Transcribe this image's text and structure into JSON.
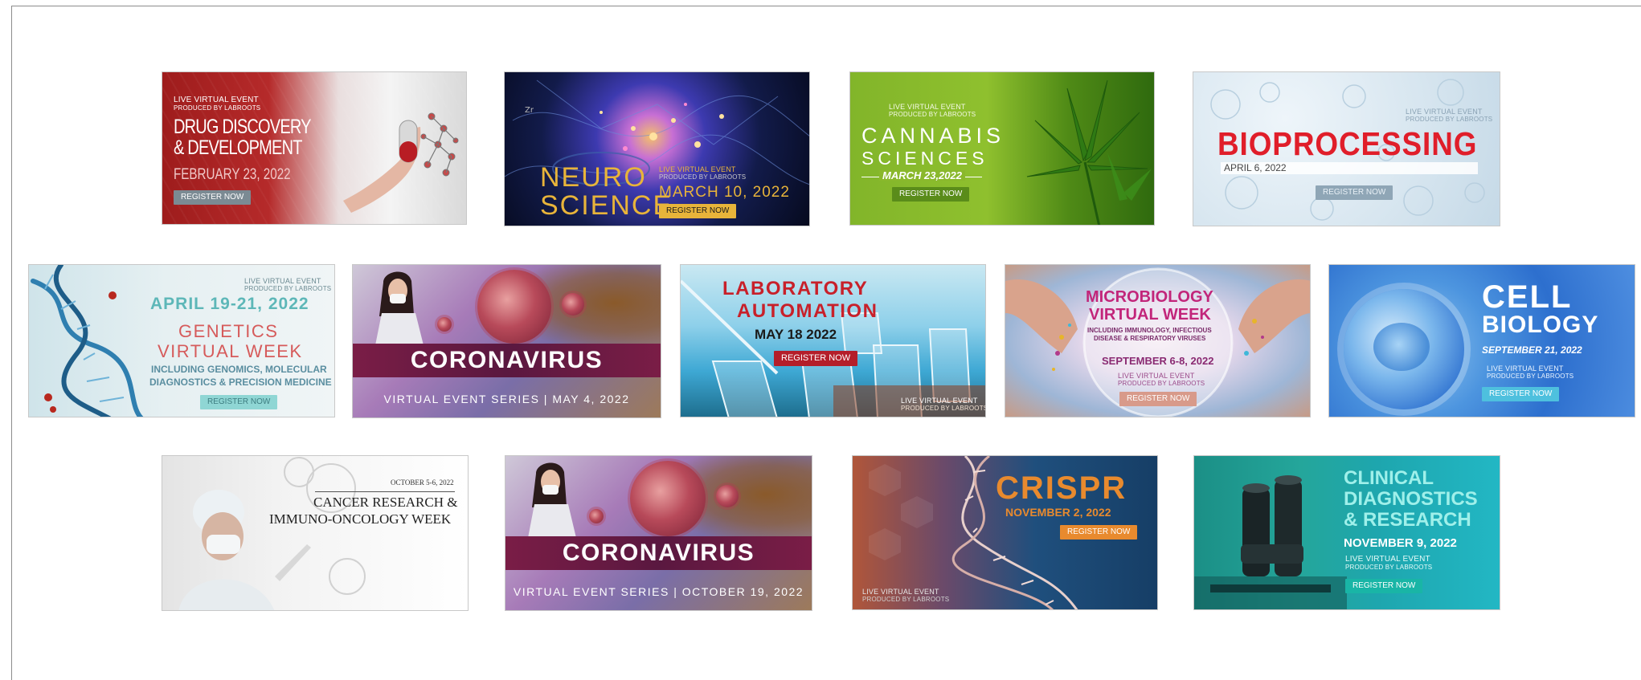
{
  "banners": {
    "drug": {
      "kicker": "LIVE VIRTUAL EVENT",
      "producer": "PRODUCED BY LABROOTS",
      "title_line1": "DRUG DISCOVERY",
      "title_line2": "& DEVELOPMENT",
      "date": "FEBRUARY 23, 2022",
      "button": "REGISTER NOW"
    },
    "neuro": {
      "title_line1": "NEURO",
      "title_line2": "SCIENCE",
      "kicker": "LIVE VIRTUAL EVENT",
      "producer": "PRODUCED BY LABROOTS",
      "date": "MARCH 10, 2022",
      "button": "REGISTER NOW"
    },
    "cannabis": {
      "kicker": "LIVE VIRTUAL EVENT",
      "producer": "PRODUCED BY LABROOTS",
      "title_line1": "CANNABIS",
      "title_line2": "SCIENCES",
      "date": "MARCH 23,2022",
      "button": "REGISTER NOW"
    },
    "bio": {
      "kicker": "LIVE VIRTUAL EVENT",
      "producer": "PRODUCED BY LABROOTS",
      "title": "BIOPROCESSING",
      "date": "APRIL 6, 2022",
      "button": "REGISTER NOW"
    },
    "genetics": {
      "kicker": "LIVE VIRTUAL EVENT",
      "producer": "PRODUCED BY LABROOTS",
      "date": "APRIL 19-21, 2022",
      "title_line1": "GENETICS",
      "title_line2": "VIRTUAL WEEK",
      "subtitle_line1": "INCLUDING GENOMICS, MOLECULAR",
      "subtitle_line2": "DIAGNOSTICS & PRECISION MEDICINE",
      "button": "REGISTER NOW"
    },
    "corona1": {
      "title": "CORONAVIRUS",
      "subtitle": "VIRTUAL EVENT SERIES  |  MAY 4, 2022"
    },
    "labauto": {
      "title_line1": "LABORATORY",
      "title_line2": "AUTOMATION",
      "date": "MAY 18  2022",
      "button": "REGISTER NOW",
      "kicker": "LIVE VIRTUAL EVENT",
      "producer": "PRODUCED BY LABROOTS"
    },
    "micro": {
      "title_line1": "MICROBIOLOGY",
      "title_line2": "VIRTUAL WEEK",
      "subtitle_line1": "INCLUDING IMMUNOLOGY, INFECTIOUS",
      "subtitle_line2": "DISEASE & RESPIRATORY VIRUSES",
      "date": "SEPTEMBER 6-8, 2022",
      "kicker": "LIVE VIRTUAL EVENT",
      "producer": "PRODUCED BY LABROOTS",
      "button": "REGISTER NOW"
    },
    "cell": {
      "title_line1": "CELL",
      "title_line2": "BIOLOGY",
      "date": "SEPTEMBER 21, 2022",
      "kicker": "LIVE VIRTUAL EVENT",
      "producer": "PRODUCED BY LABROOTS",
      "button": "REGISTER NOW"
    },
    "cancer": {
      "date": "OCTOBER 5-6, 2022",
      "title_line1": "CANCER RESEARCH &",
      "title_line2": "IMMUNO-ONCOLOGY WEEK"
    },
    "corona2": {
      "title": "CORONAVIRUS",
      "subtitle": "VIRTUAL EVENT SERIES | OCTOBER 19, 2022"
    },
    "crispr": {
      "title": "CRISPR",
      "date": "NOVEMBER 2, 2022",
      "button": "REGISTER NOW",
      "kicker": "LIVE VIRTUAL EVENT",
      "producer": "PRODUCED BY LABROOTS"
    },
    "clinical": {
      "title_line1": "CLINICAL",
      "title_line2": "DIAGNOSTICS",
      "title_line3": "& RESEARCH",
      "date": "NOVEMBER 9, 2022",
      "kicker": "LIVE VIRTUAL EVENT",
      "producer": "PRODUCED BY LABROOTS",
      "button": "REGISTER NOW"
    }
  },
  "colors": {
    "drug_accent": "#9e1c1c",
    "neuro_gold": "#e8b43a",
    "cannabis_green": "#82b52a",
    "bio_red": "#e01e2a",
    "genetics_red": "#d65b5b",
    "corona_band": "#7a1d46",
    "labauto_red": "#c8202a",
    "micro_magenta": "#c2257a",
    "crispr_orange": "#e88a2e",
    "clinical_teal": "#19b5a6"
  },
  "icons": {
    "hand_capsule": "hand-holding-capsule-icon",
    "brain_network": "neural-network-icon",
    "cannabis_leaf": "cannabis-leaf-icon",
    "cell_pattern": "cell-pattern-icon",
    "dna_helix": "dna-helix-icon",
    "virus": "virus-icon",
    "test_tubes": "test-tubes-icon",
    "petri_hands": "hands-petri-dish-icon",
    "cell_sphere": "cell-sphere-icon",
    "scientist": "scientist-icon",
    "microscope": "microscope-icon"
  }
}
